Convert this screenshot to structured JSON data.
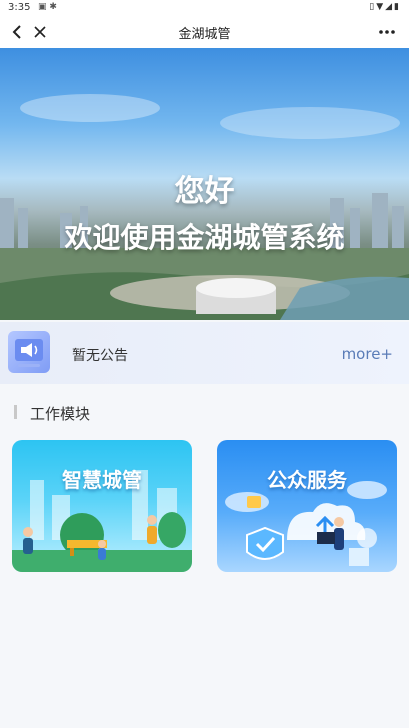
{
  "status_bar": {
    "time": "3:35",
    "notification_icons": [
      "image-icon",
      "bug-icon"
    ],
    "right_icons": [
      "vibrate-icon",
      "wifi-icon",
      "signal-icon",
      "battery-icon"
    ]
  },
  "nav": {
    "title": "金湖城管"
  },
  "banner": {
    "greeting": "您好",
    "welcome": "欢迎使用金湖城管系统"
  },
  "notice": {
    "text": "暂无公告",
    "more": "more+"
  },
  "section": {
    "title": "工作模块"
  },
  "modules": [
    {
      "label": "智慧城管"
    },
    {
      "label": "公众服务"
    }
  ]
}
